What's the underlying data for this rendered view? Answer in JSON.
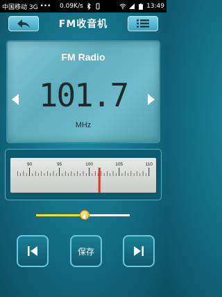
{
  "status_bar": {
    "carrier": "中国移动 3G",
    "dots": "•••",
    "speed": "0.09K/s",
    "time": "13:49"
  },
  "header": {
    "title": "FM收音机",
    "back_icon": "back-arrow-icon",
    "menu_icon": "list-icon"
  },
  "display": {
    "band_label": "FM Radio",
    "frequency": "101.7",
    "unit": "MHz"
  },
  "tuner": {
    "tick_labels": [
      "90",
      "95",
      "100",
      "105",
      "110"
    ],
    "range": [
      87.5,
      110.5
    ],
    "current": 101.7,
    "needle_color": "#d83a2a"
  },
  "volume": {
    "level": 0.52,
    "fill_color": "#f2e21b"
  },
  "controls": {
    "prev_icon": "skip-previous-icon",
    "save_label": "保存",
    "next_icon": "skip-next-icon"
  }
}
